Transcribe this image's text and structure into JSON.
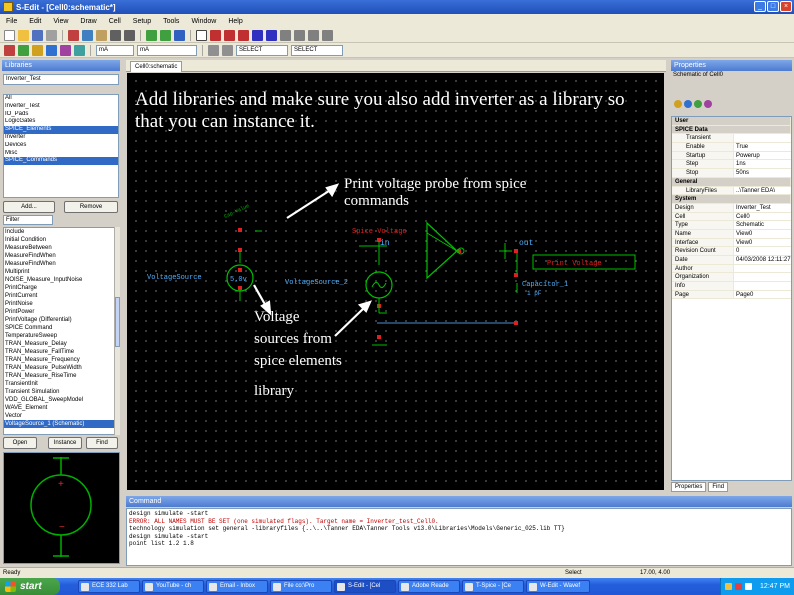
{
  "window": {
    "title": "S-Edit - [Cell0:schematic*]"
  },
  "menu": [
    "File",
    "Edit",
    "View",
    "Draw",
    "Cell",
    "Setup",
    "Tools",
    "Window",
    "Help"
  ],
  "toolbar": {
    "field1": "mA",
    "field2": "mA",
    "field3": "SELECT",
    "field4": "SELECT"
  },
  "libraries": {
    "title": "Libraries",
    "selected": "Inverter_Test",
    "items": [
      "All",
      "Inverter_Test",
      "IO_Pads",
      "LogicGates",
      "SPICE_Elements",
      "Inverter",
      "Devices",
      "Misc",
      "SPICE_Commands"
    ],
    "selected_index": 4,
    "add_label": "Add...",
    "remove_label": "Remove",
    "filter": "Filter",
    "cells": [
      "Include",
      "Initial Condition",
      "MeasureBetween",
      "MeasureFindWhen",
      "MeasureFindWhen",
      "Multiprint",
      "NOISE_Measure_InputNoise",
      "PrintCharge",
      "PrintCurrent",
      "PrintNoise",
      "PrintPower",
      "PrintVoltage (Differential)",
      "SPICE Command",
      "TemperatureSweep",
      "TRAN_Measure_Delay",
      "TRAN_Measure_FallTime",
      "TRAN_Measure_Frequency",
      "TRAN_Measure_PulseWidth",
      "TRAN_Measure_RiseTime",
      "TransientInit",
      "Transient Simulation",
      "VDD_GLOBAL_SweepModel",
      "WAVE_Element",
      "Vector",
      "VoltageSource_1 (Schematic)"
    ],
    "cells_selected_index": 24,
    "open_label": "Open",
    "instance_label": "Instance",
    "find_label": "Find"
  },
  "tab": {
    "label": "Cell0:schematic"
  },
  "annotations": {
    "main": "Add libraries and make sure you also add inverter as a library so that you can instance it.",
    "probe": "Print voltage probe from spice commands",
    "sources_line1": "Voltage",
    "sources_line2": "sources from",
    "sources_line3": "spice elements",
    "sources_line4": "library"
  },
  "schematic": {
    "spice_voltage": "Spice Voltage",
    "voltage_source": "VoltageSource",
    "voltage_source_2": "VoltageSource_2",
    "five_v": "5.0v",
    "inv_in": "in",
    "inv_out": "out",
    "print_voltage": "Print Voltage",
    "capacitor": "Capacitor_1",
    "cap_value": "1 pF",
    "cap_label": "Cap-Value"
  },
  "properties": {
    "title": "Properties",
    "subtitle": "Schematic of Cell0",
    "rows": [
      {
        "k": "User",
        "v": "",
        "cat": true
      },
      {
        "k": "SPICE Data",
        "v": "",
        "cat": true
      },
      {
        "k": "Transient",
        "v": "",
        "sub": true
      },
      {
        "k": "Enable",
        "v": "True",
        "sub": true
      },
      {
        "k": "Startup",
        "v": "Powerup",
        "sub": true
      },
      {
        "k": "Step",
        "v": "1ns",
        "sub": true
      },
      {
        "k": "Stop",
        "v": "50ns",
        "sub": true
      },
      {
        "k": "General",
        "v": "",
        "cat": true
      },
      {
        "k": "LibraryFiles",
        "v": "..\\Tanner EDA\\",
        "sub": true
      },
      {
        "k": "System",
        "v": "",
        "cat": true
      },
      {
        "k": "Design",
        "v": "Inverter_Test"
      },
      {
        "k": "Cell",
        "v": "Cell0"
      },
      {
        "k": "Type",
        "v": "Schematic"
      },
      {
        "k": "Name",
        "v": "View0"
      },
      {
        "k": "Interface",
        "v": "View0"
      },
      {
        "k": "Revision Count",
        "v": "0"
      },
      {
        "k": "Date",
        "v": "04/03/2008 12:11:27"
      },
      {
        "k": "Author",
        "v": ""
      },
      {
        "k": "Organization",
        "v": ""
      },
      {
        "k": "Info",
        "v": ""
      },
      {
        "k": "Page",
        "v": "Page0"
      }
    ],
    "tab1": "Properties",
    "tab2": "Find"
  },
  "command": {
    "title": "Command",
    "lines": [
      {
        "text": "design simulate -start",
        "err": false
      },
      {
        "text": "ERROR: ALL NAMES MUST BE SET (one simulated flags). Target name = Inverter_test_Cell0.",
        "err": true
      },
      {
        "text": "technology simulation set general -libraryfiles {..\\..\\Tanner EDA\\Tanner Tools v13.0\\Libraries\\Models\\Generic_025.lib TT}",
        "err": false
      },
      {
        "text": "design simulate -start",
        "err": false
      },
      {
        "text": "point list 1.2 1.8",
        "err": false
      }
    ]
  },
  "status": {
    "left": "Ready",
    "right": "Select",
    "coord": "17.00, 4.00"
  },
  "taskbar": {
    "start": "start",
    "tasks": [
      "ECE 332 Lab",
      "YouTube - ch",
      "Email - Inbox",
      "File co:\\Pro",
      "S-Edit - [Cel",
      "Adobe Reade",
      "T-Spice - [Ce",
      "W-Edit - Wavef"
    ],
    "active_index": 4,
    "clock": "12:47 PM"
  }
}
